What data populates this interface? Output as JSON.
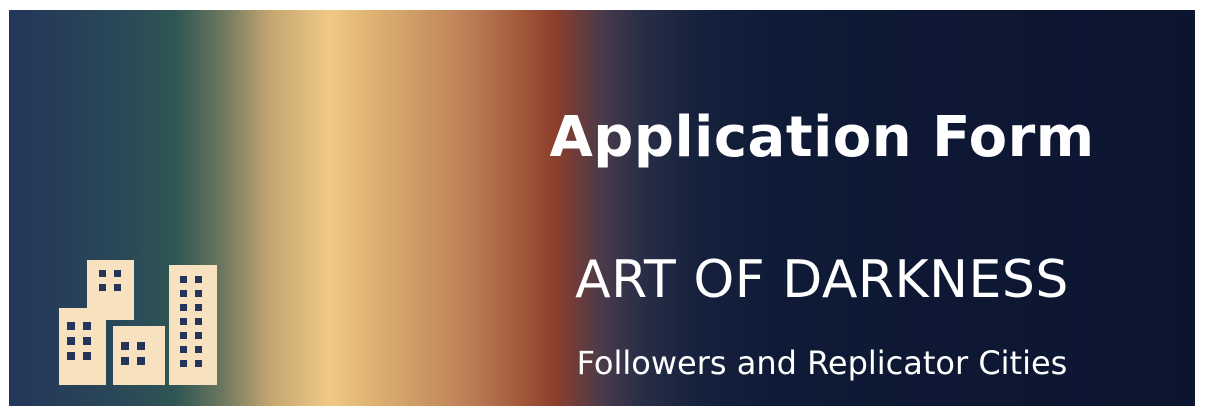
{
  "banner": {
    "title": "Application Form",
    "subtitle": "ART OF DARKNESS",
    "tagline": "Followers and Replicator Cities",
    "icon": "city-buildings-icon",
    "icon_color": "#f7e1bf"
  }
}
